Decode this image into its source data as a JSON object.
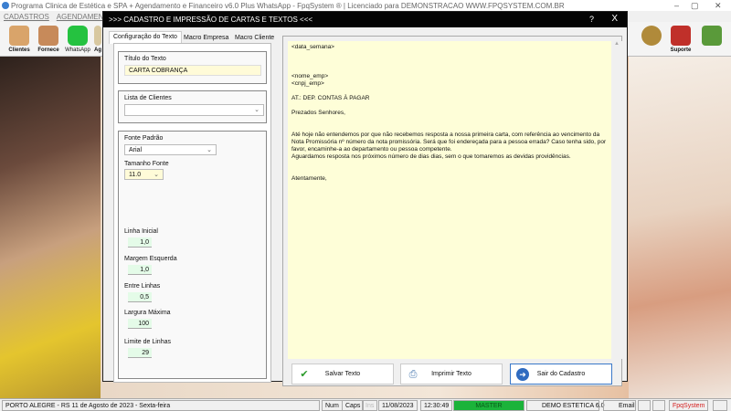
{
  "app": {
    "title": "Programa Clinica de Estética e SPA + Agendamento e Financeiro v6.0 Plus WhatsApp - FpqSystem ® | Licenciado para  DEMONSTRACAO WWW.FPQSYSTEM.COM.BR",
    "menu": [
      "CADASTROS",
      "AGENDAMENTO"
    ],
    "toolbar": [
      {
        "label": "Clientes",
        "icon": "clients-icon"
      },
      {
        "label": "Fornece",
        "icon": "supplier-icon"
      },
      {
        "label": "WhatsApp",
        "icon": "whatsapp-icon"
      },
      {
        "label": "Ag",
        "icon": "agenda-icon"
      },
      {
        "label": "",
        "icon": "money-icon"
      },
      {
        "label": "Suporte",
        "icon": "support-icon"
      },
      {
        "label": "",
        "icon": "exit-icon"
      }
    ],
    "window_controls": {
      "minimize": "–",
      "maximize": "▢",
      "close": "✕"
    }
  },
  "dialog": {
    "title": ">>>  CADASTRO E IMPRESSÃO DE CARTAS E TEXTOS  <<<",
    "help": "?",
    "close": "X",
    "tabs": [
      "Configuração do Texto",
      "Macro Empresa",
      "Macro Cliente"
    ],
    "titulo_label": "Título do Texto",
    "titulo_value": "CARTA COBRANÇA",
    "clientes_label": "Lista de Clientes",
    "clientes_value": "",
    "fonte_label": "Fonte Padrão",
    "fonte_value": "Arial",
    "tamanho_label": "Tamanho Fonte",
    "tamanho_value": "11.0",
    "fields": [
      {
        "label": "Linha Inicial",
        "value": "1,0"
      },
      {
        "label": "Margem Esquerda",
        "value": "1,0"
      },
      {
        "label": "Entre Linhas",
        "value": "0,5"
      },
      {
        "label": "Largura Máxima",
        "value": "100"
      },
      {
        "label": "Limite de Linhas",
        "value": "29"
      }
    ],
    "text": "<data_semana>\n\n\n\n<nome_emp>\n<cnpj_emp>\n\nAT.: DEP. CONTAS À PAGAR\n\nPrezados Senhores,\n\n\nAté hoje não entendemos por que não recebemos resposta a nossa primeira carta, com referência ao vencimento da Nota Promissória nº número da nota promissória. Será que foi endereçada para a pessoa errada? Caso tenha sido, por favor, encaminhe-a ao departamento ou pessoa competente.\nAguardamos resposta nos próximos número de dias dias, sem o que tomaremos as devidas providências.\n\n\nAtentamente,",
    "buttons": {
      "save": "Salvar Texto",
      "print": "Imprimir Texto",
      "exit": "Sair do Cadastro"
    }
  },
  "status": {
    "location": "PORTO ALEGRE - RS 11 de Agosto de 2023 - Sexta-feira",
    "num": "Num",
    "caps": "Caps",
    "ins": "Ins",
    "date": "11/08/2023",
    "time": "12:30:49",
    "user": "MASTER",
    "db": "DEMO ESTETICA 6.0",
    "email": "Email",
    "brand": "FpqSystem"
  },
  "colors": {
    "master": "#1bb33a",
    "brand": "#d42020"
  }
}
